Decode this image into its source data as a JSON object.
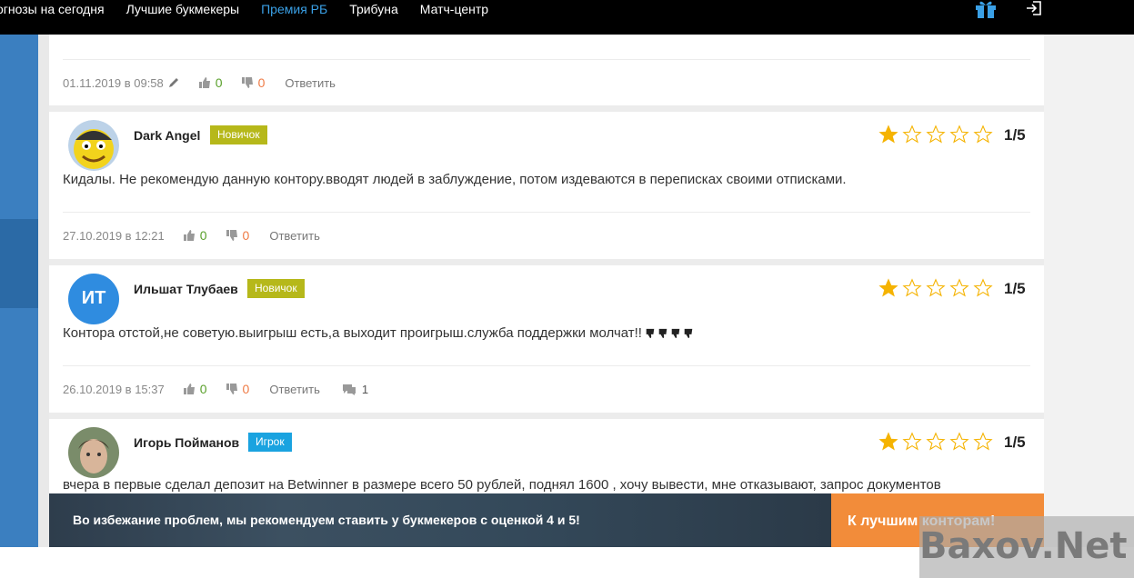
{
  "nav": {
    "items": [
      "огнозы на сегодня",
      "Лучшие букмекеры",
      "Премия РБ",
      "Трибуна",
      "Матч-центр"
    ],
    "active_index": 2,
    "accent_color": "#3aa0e6"
  },
  "icons": {
    "gift": "gift-icon",
    "exit": "exit-icon",
    "pencil": "pencil-icon",
    "like": "thumbs-up-icon",
    "dislike": "thumbs-down-icon",
    "comment": "comment-bubble-icon",
    "star": "star-icon"
  },
  "comments": [
    {
      "date": "01.11.2019 в 09:58",
      "likes": "0",
      "dislikes": "0",
      "reply_label": "Ответить"
    },
    {
      "username": "Dark Angel",
      "badge": "Новичок",
      "rating_stars": 1,
      "rating_text": "1/5",
      "text": "Кидалы. Не рекомендую данную контору.вводят людей в заблуждение, потом издеваются в переписках своими отписками.",
      "date": "27.10.2019 в 12:21",
      "likes": "0",
      "dislikes": "0",
      "reply_label": "Ответить"
    },
    {
      "username": "Ильшат Тлубаев",
      "avatar_initials": "ИТ",
      "badge": "Новичок",
      "rating_stars": 1,
      "rating_text": "1/5",
      "text": "Контора отстой,не советую.выигрыш есть,а выходит проигрыш.служба поддержки молчат!!",
      "date": "26.10.2019 в 15:37",
      "likes": "0",
      "dislikes": "0",
      "reply_label": "Ответить",
      "replies": "1"
    },
    {
      "username": "Игорь Пойманов",
      "badge": "Игрок",
      "rating_stars": 1,
      "rating_text": "1/5",
      "text": "вчера в первые сделал депозит на Betwinner в размере всего 50 рублей, поднял 1600 , хочу вывести, мне отказывают, запрос документов"
    }
  ],
  "banner": {
    "text": "Во избежание проблем, мы рекомендуем ставить у букмекеров с оценкой 4 и 5!",
    "button_label": "К лучшим конторам!",
    "button_color": "#f28c3a"
  },
  "watermark": "Baxov.Net"
}
